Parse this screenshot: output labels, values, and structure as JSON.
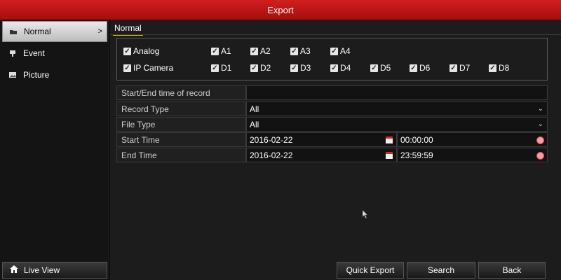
{
  "window": {
    "title": "Export"
  },
  "sidebar": {
    "items": [
      {
        "label": "Normal",
        "icon": "normal-icon",
        "active": true
      },
      {
        "label": "Event",
        "icon": "event-icon",
        "active": false
      },
      {
        "label": "Picture",
        "icon": "picture-icon",
        "active": false
      }
    ],
    "live_view": "Live View"
  },
  "tabs": {
    "active": "Normal"
  },
  "channels": {
    "analog": {
      "label": "Analog",
      "checked": true,
      "items": [
        "A1",
        "A2",
        "A3",
        "A4"
      ]
    },
    "ip": {
      "label": "IP Camera",
      "checked": true,
      "items": [
        "D1",
        "D2",
        "D3",
        "D4",
        "D5",
        "D6",
        "D7",
        "D8"
      ]
    }
  },
  "form": {
    "start_end_label": "Start/End time of record",
    "record_type_label": "Record Type",
    "record_type_value": "All",
    "file_type_label": "File Type",
    "file_type_value": "All",
    "start_time_label": "Start Time",
    "start_date": "2016-02-22",
    "start_time": "00:00:00",
    "end_time_label": "End Time",
    "end_date": "2016-02-22",
    "end_time": "23:59:59"
  },
  "buttons": {
    "quick_export": "Quick Export",
    "search": "Search",
    "back": "Back"
  },
  "colors": {
    "titlebar": "#c0161a",
    "tab_underline": "#e6c300"
  }
}
